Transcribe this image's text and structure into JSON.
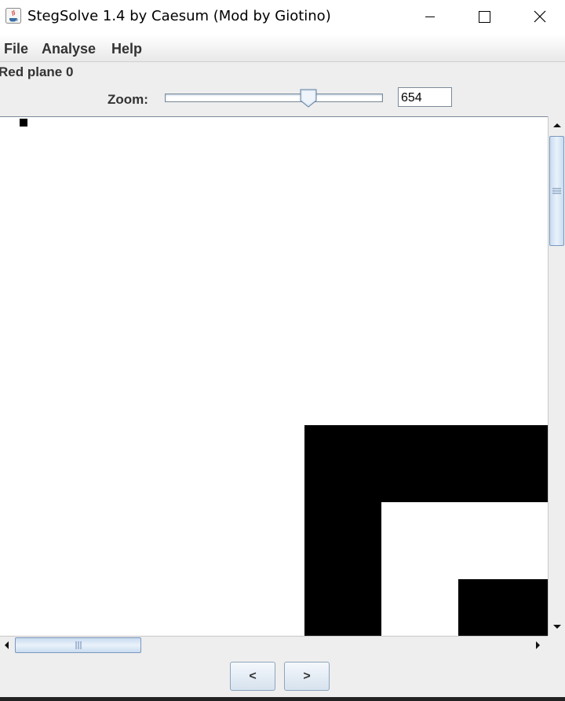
{
  "window": {
    "title": "StegSolve 1.4 by Caesum (Mod by Giotino)",
    "controls": [
      "minimize-icon",
      "maximize-icon",
      "close-icon"
    ]
  },
  "menu": {
    "items": [
      "File",
      "Analyse",
      "Help"
    ]
  },
  "plane_label": "Red plane 0",
  "zoom": {
    "label": "Zoom:",
    "value": "654",
    "slider_fraction": 0.66
  },
  "scrollbars": {
    "vertical_thumb_icon": "grip-icon",
    "horizontal_thumb_icon": "grip-icon"
  },
  "navigation": {
    "prev_label": "<",
    "next_label": ">"
  },
  "colors": {
    "accent": "#7a98c0",
    "canvas_bg": "#ffffff",
    "pixel_on": "#000000"
  }
}
